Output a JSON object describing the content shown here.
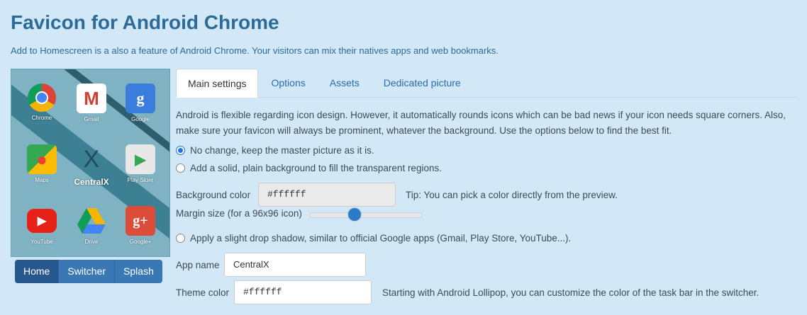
{
  "header": {
    "title": "Favicon for Android Chrome",
    "subtitle": "Add to Homescreen is a also a feature of Android Chrome. Your visitors can mix their natives apps and web bookmarks."
  },
  "preview": {
    "apps": [
      {
        "label": "Chrome",
        "icon": "chrome-icon"
      },
      {
        "label": "Gmail",
        "icon": "gmail-icon"
      },
      {
        "label": "Google",
        "icon": "google-icon"
      },
      {
        "label": "Maps",
        "icon": "maps-icon"
      },
      {
        "label": "CentralX",
        "icon": "centralx-icon"
      },
      {
        "label": "Play Store",
        "icon": "play-store-icon"
      },
      {
        "label": "YouTube",
        "icon": "youtube-icon"
      },
      {
        "label": "Drive",
        "icon": "drive-icon"
      },
      {
        "label": "Google+",
        "icon": "google-plus-icon"
      }
    ],
    "modes": [
      "Home",
      "Switcher",
      "Splash"
    ],
    "active_mode": "Home"
  },
  "tabs": [
    {
      "label": "Main settings",
      "active": true
    },
    {
      "label": "Options",
      "active": false
    },
    {
      "label": "Assets",
      "active": false
    },
    {
      "label": "Dedicated picture",
      "active": false
    }
  ],
  "main": {
    "description": "Android is flexible regarding icon design. However, it automatically rounds icons which can be bad news if your icon needs square corners. Also, make sure your favicon will always be prominent, whatever the background. Use the options below to find the best fit.",
    "option_no_change": "No change, keep the master picture as it is.",
    "option_background": "Add a solid, plain background to fill the transparent regions.",
    "background_color_label": "Background color",
    "background_color_value": "#ffffff",
    "background_tip": "Tip: You can pick a color directly from the preview.",
    "margin_label": "Margin size (for a 96x96 icon)",
    "margin_fraction": 0.4,
    "option_shadow": "Apply a slight drop shadow, similar to official Google apps (Gmail, Play Store, YouTube...).",
    "app_name_label": "App name",
    "app_name_value": "CentralX",
    "theme_color_label": "Theme color",
    "theme_color_value": "#ffffff",
    "theme_color_tip": "Starting with Android Lollipop, you can customize the color of the task bar in the switcher.",
    "selected_option": "no_change"
  },
  "colors": {
    "title": "#2a6b9a",
    "accent": "#2a7cc7",
    "background": "#d3e8f6"
  }
}
